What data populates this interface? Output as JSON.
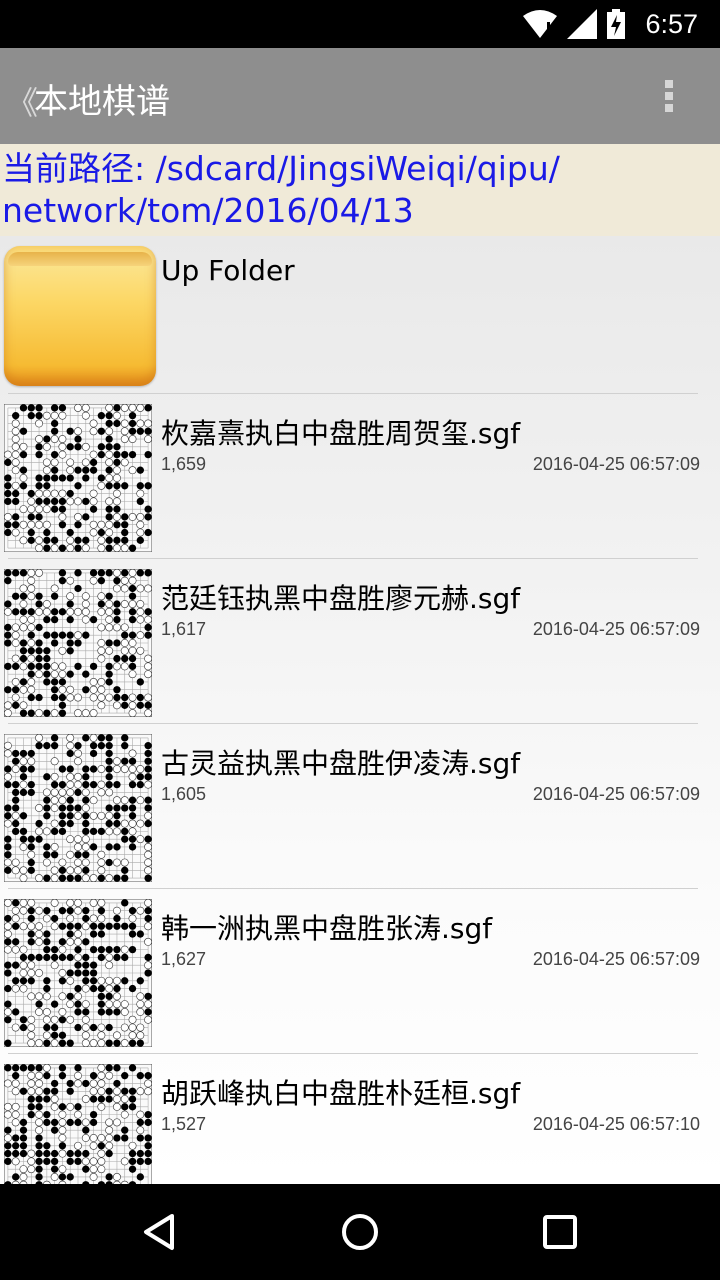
{
  "status": {
    "time": "6:57"
  },
  "actionbar": {
    "back_glyph": "《",
    "title": "本地棋谱",
    "overflow_icon": "overflow-menu-icon"
  },
  "path": {
    "text": "当前路径: /sdcard/JingsiWeiqi/qipu/ network/tom/2016/04/13"
  },
  "list": {
    "up_folder": {
      "label": "Up Folder",
      "icon": "folder-icon"
    },
    "files": [
      {
        "name": "杴嘉熹执白中盘胜周贺玺.sgf",
        "size": "1,659",
        "date": "2016-04-25 06:57:09"
      },
      {
        "name": "范廷钰执黑中盘胜廖元赫.sgf",
        "size": "1,617",
        "date": "2016-04-25 06:57:09"
      },
      {
        "name": "古灵益执黑中盘胜伊凌涛.sgf",
        "size": "1,605",
        "date": "2016-04-25 06:57:09"
      },
      {
        "name": "韩一洲执黑中盘胜张涛.sgf",
        "size": "1,627",
        "date": "2016-04-25 06:57:09"
      },
      {
        "name": "胡跃峰执白中盘胜朴廷桓.sgf",
        "size": "1,527",
        "date": "2016-04-25 06:57:10"
      }
    ]
  },
  "navbar": {
    "back": "back-icon",
    "home": "home-icon",
    "recents": "recents-icon"
  }
}
